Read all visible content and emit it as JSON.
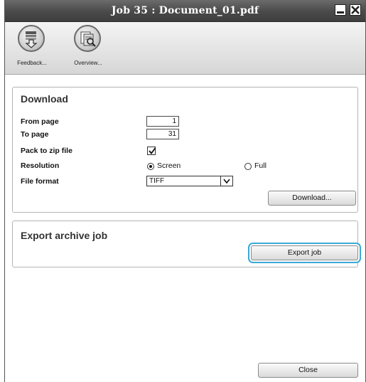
{
  "window": {
    "title": "Job 35 : Document_01.pdf"
  },
  "toolbar": {
    "items": [
      {
        "label": "Feedback..."
      },
      {
        "label": "Overview..."
      }
    ]
  },
  "download": {
    "title": "Download",
    "from_page": {
      "label": "From page",
      "value": "1"
    },
    "to_page": {
      "label": "To page",
      "value": "31"
    },
    "pack_zip": {
      "label": "Pack to zip file",
      "checked": true
    },
    "resolution": {
      "label": "Resolution",
      "options": [
        {
          "label": "Screen",
          "selected": true
        },
        {
          "label": "Full",
          "selected": false
        }
      ]
    },
    "file_format": {
      "label": "File format",
      "value": "TIFF"
    },
    "button": "Download..."
  },
  "export": {
    "title": "Export archive job",
    "button": "Export job"
  },
  "footer": {
    "close_button": "Close"
  }
}
